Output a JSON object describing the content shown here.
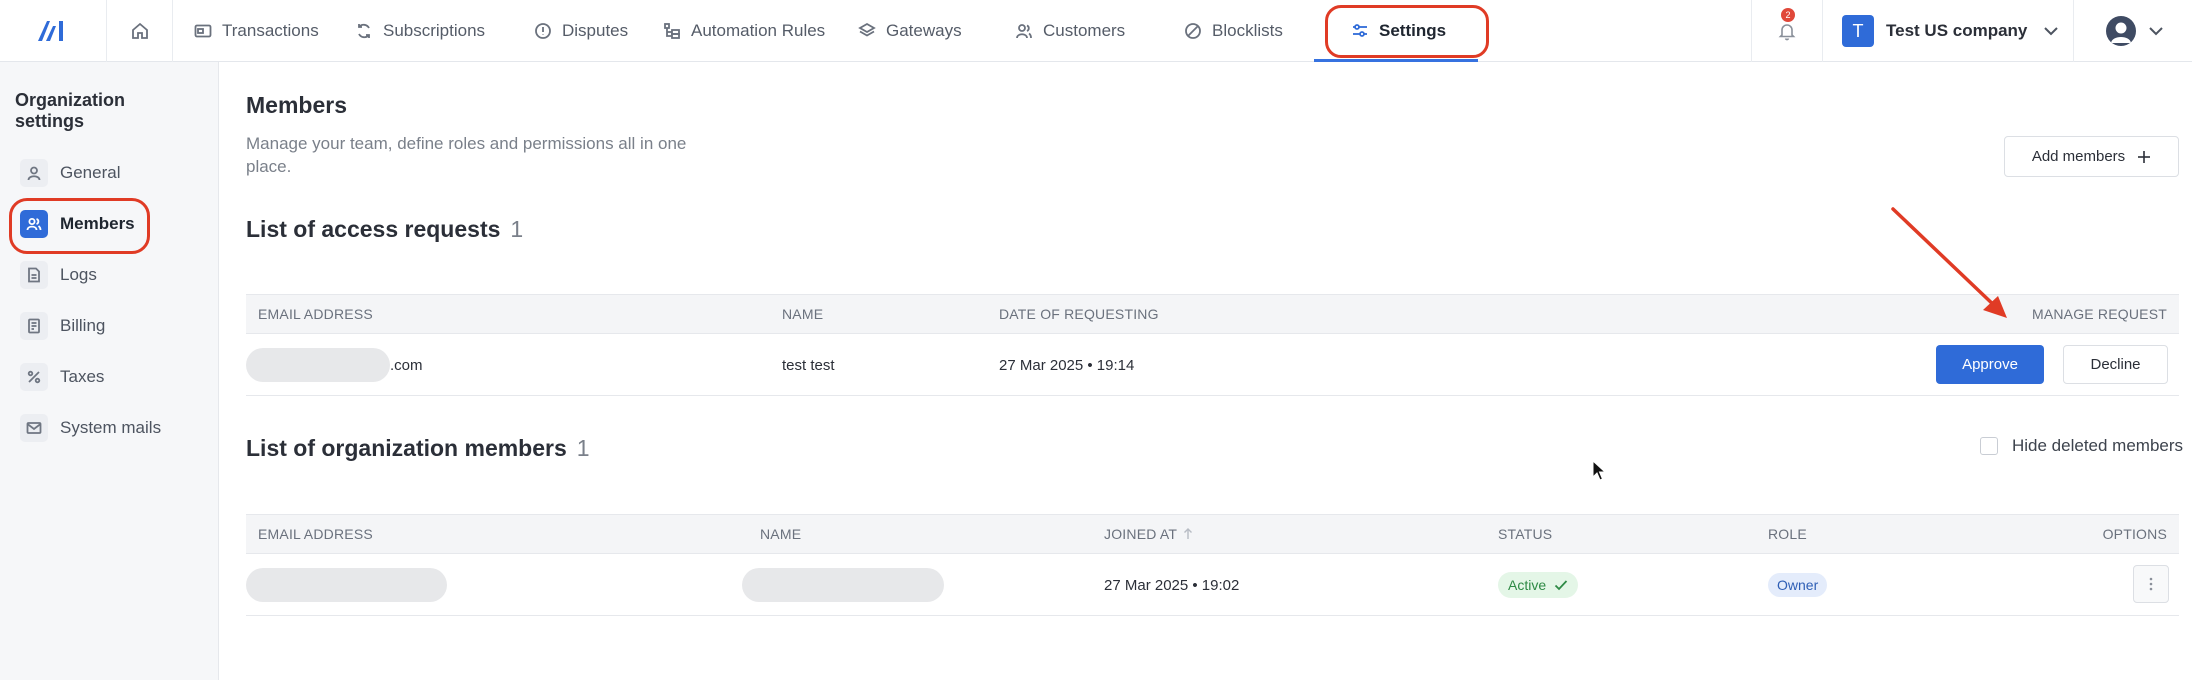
{
  "nav": {
    "logo_text": "AI",
    "home_icon": "home-icon",
    "items": [
      {
        "label": "Transactions",
        "icon": "card-icon"
      },
      {
        "label": "Subscriptions",
        "icon": "refresh-icon"
      },
      {
        "label": "Disputes",
        "icon": "alert-circle-icon"
      },
      {
        "label": "Automation Rules",
        "icon": "flow-icon"
      },
      {
        "label": "Gateways",
        "icon": "layers-icon"
      },
      {
        "label": "Customers",
        "icon": "users-icon"
      },
      {
        "label": "Blocklists",
        "icon": "ban-icon"
      },
      {
        "label": "Settings",
        "icon": "sliders-icon",
        "active": true
      }
    ],
    "notification_count": "2",
    "company_initial": "T",
    "company_name": "Test US company"
  },
  "sidebar": {
    "title": "Organization settings",
    "items": [
      {
        "label": "General",
        "icon": "user-icon"
      },
      {
        "label": "Members",
        "icon": "users-icon",
        "active": true
      },
      {
        "label": "Logs",
        "icon": "document-icon"
      },
      {
        "label": "Billing",
        "icon": "receipt-icon"
      },
      {
        "label": "Taxes",
        "icon": "percent-icon"
      },
      {
        "label": "System mails",
        "icon": "mail-icon"
      }
    ]
  },
  "main": {
    "title": "Members",
    "description": "Manage your team, define roles and permissions all in one place.",
    "add_members_label": "Add members",
    "access_requests": {
      "title": "List of access requests",
      "count": "1",
      "columns": [
        "EMAIL ADDRESS",
        "NAME",
        "DATE OF REQUESTING",
        "MANAGE REQUEST"
      ],
      "rows": [
        {
          "email_suffix": ".com",
          "name": "test test",
          "date": "27 Mar 2025 • 19:14",
          "approve_label": "Approve",
          "decline_label": "Decline"
        }
      ]
    },
    "members": {
      "title": "List of organization members",
      "count": "1",
      "hide_deleted_label": "Hide deleted members",
      "columns": [
        "EMAIL ADDRESS",
        "NAME",
        "JOINED AT",
        "STATUS",
        "ROLE",
        "OPTIONS"
      ],
      "rows": [
        {
          "joined_at": "27 Mar 2025 • 19:02",
          "status": "Active",
          "role": "Owner"
        }
      ]
    }
  },
  "colors": {
    "accent": "#2f6bd8",
    "annotation": "#e03b25",
    "status_active": "#2e8a45",
    "role_owner": "#2f5fb5"
  }
}
